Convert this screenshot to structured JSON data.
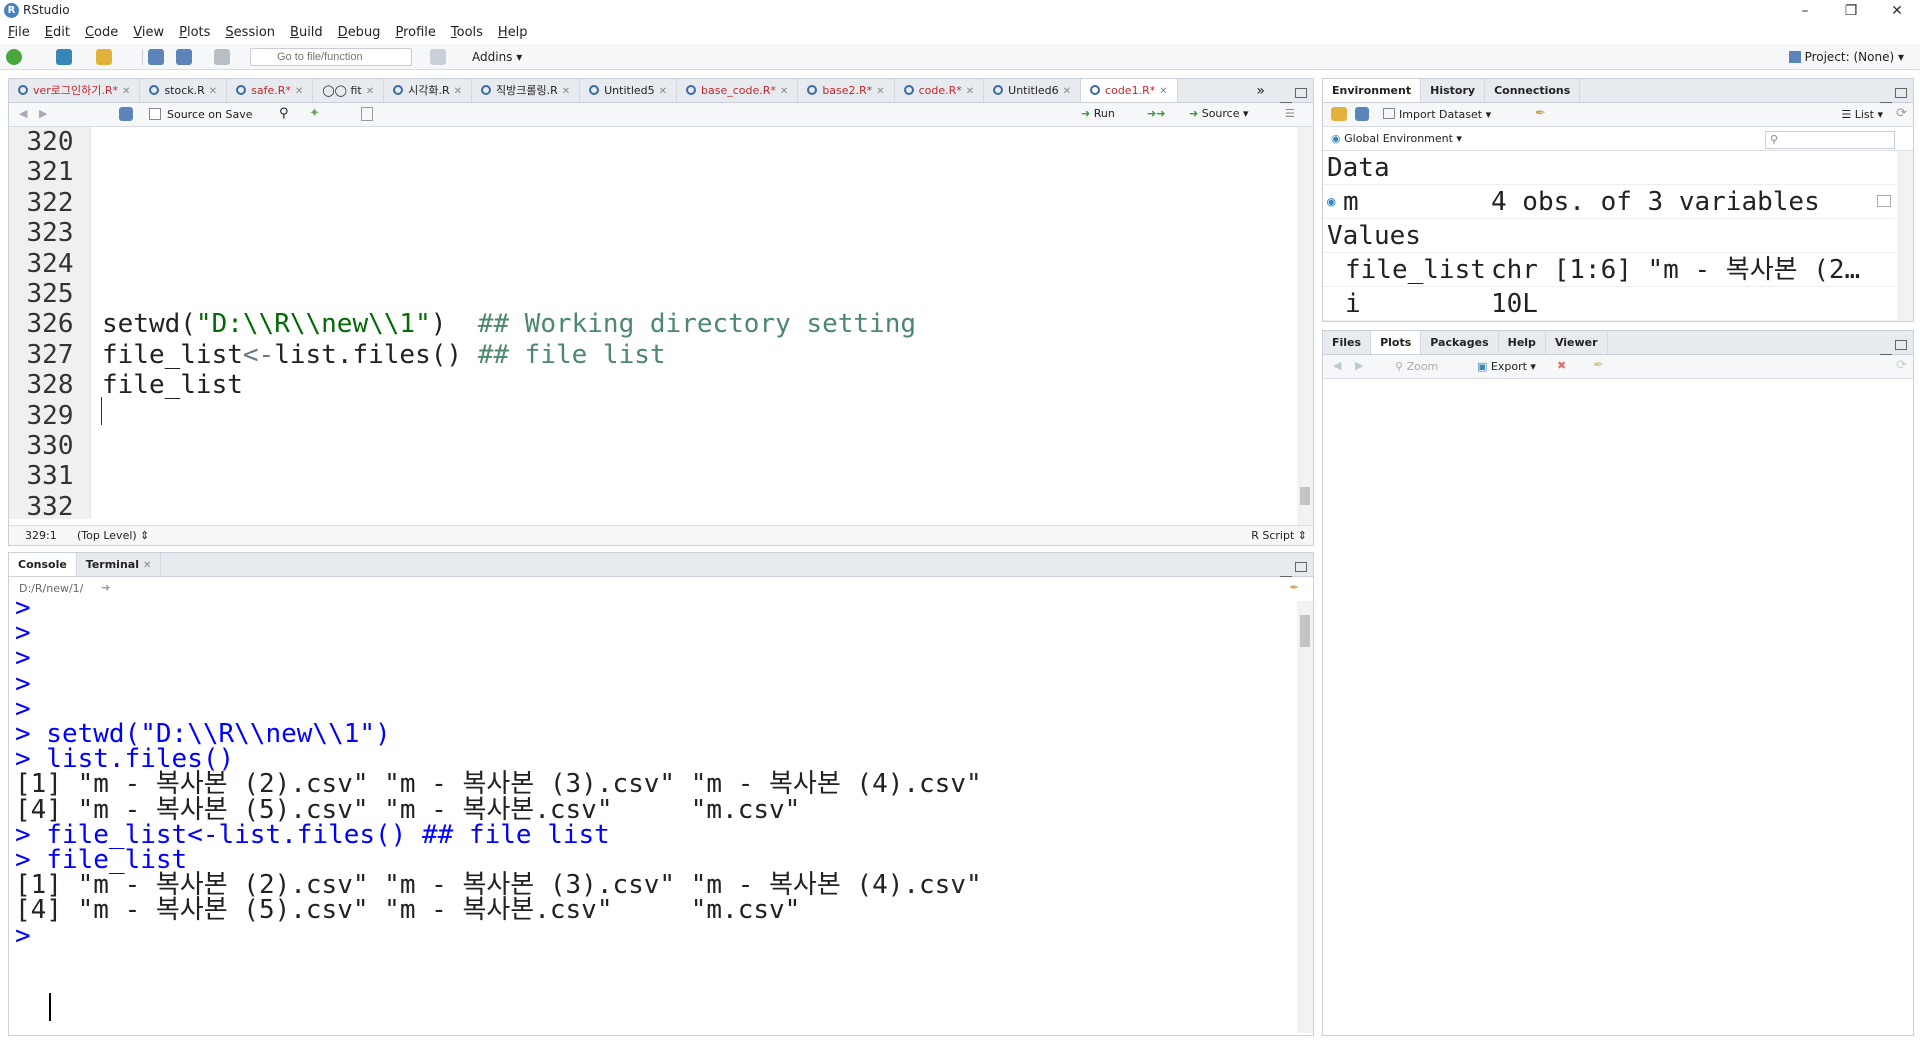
{
  "window": {
    "title": "RStudio"
  },
  "menu": [
    "File",
    "Edit",
    "Code",
    "View",
    "Plots",
    "Session",
    "Build",
    "Debug",
    "Profile",
    "Tools",
    "Help"
  ],
  "toolbar": {
    "goto_placeholder": "Go to file/function",
    "addins": "Addins",
    "project": "Project: (None)"
  },
  "editor": {
    "tabs": [
      {
        "label": "ver로그인하기.R*",
        "modified": true
      },
      {
        "label": "stock.R",
        "modified": false
      },
      {
        "label": "safe.R*",
        "modified": true
      },
      {
        "label": "fit",
        "modified": false
      },
      {
        "label": "시각화.R",
        "modified": false
      },
      {
        "label": "직방크롤링.R",
        "modified": false
      },
      {
        "label": "Untitled5",
        "modified": false
      },
      {
        "label": "base_code.R*",
        "modified": true
      },
      {
        "label": "base2.R*",
        "modified": true
      },
      {
        "label": "code.R*",
        "modified": true
      },
      {
        "label": "Untitled6",
        "modified": false
      },
      {
        "label": "code1.R*",
        "modified": true
      }
    ],
    "source_on_save": "Source on Save",
    "run_label": "Run",
    "source_label": "Source",
    "lines": [
      {
        "num": "320",
        "code": ""
      },
      {
        "num": "321",
        "code": ""
      },
      {
        "num": "322",
        "code": ""
      },
      {
        "num": "323",
        "code": ""
      },
      {
        "num": "324",
        "code": ""
      },
      {
        "num": "325",
        "code": ""
      },
      {
        "num": "326",
        "code": "setwd(\"D:\\\\R\\\\new\\\\1\")  ## Working directory setting"
      },
      {
        "num": "327",
        "code": "file_list<-list.files() ## file list"
      },
      {
        "num": "328",
        "code": "file_list"
      },
      {
        "num": "329",
        "code": ""
      },
      {
        "num": "330",
        "code": ""
      },
      {
        "num": "331",
        "code": ""
      },
      {
        "num": "332",
        "code": ""
      }
    ],
    "status_position": "329:1",
    "status_scope": "(Top Level)",
    "status_type": "R Script"
  },
  "console": {
    "tabs": [
      "Console",
      "Terminal"
    ],
    "path": "D:/R/new/1/",
    "lines": [
      {
        "prompt": ">",
        "text": ""
      },
      {
        "prompt": ">",
        "text": ""
      },
      {
        "prompt": ">",
        "text": ""
      },
      {
        "prompt": ">",
        "text": ""
      },
      {
        "prompt": ">",
        "text": ""
      },
      {
        "prompt": ">",
        "text": " setwd(\"D:\\\\R\\\\new\\\\1\")"
      },
      {
        "prompt": ">",
        "text": " list.files()"
      },
      {
        "prompt": "",
        "text": "[1] \"m - 복사본 (2).csv\" \"m - 복사본 (3).csv\" \"m - 복사본 (4).csv\""
      },
      {
        "prompt": "",
        "text": "[4] \"m - 복사본 (5).csv\" \"m - 복사본.csv\"     \"m.csv\""
      },
      {
        "prompt": ">",
        "text": " file_list<-list.files() ## file list"
      },
      {
        "prompt": ">",
        "text": " file_list"
      },
      {
        "prompt": "",
        "text": "[1] \"m - 복사본 (2).csv\" \"m - 복사본 (3).csv\" \"m - 복사본 (4).csv\""
      },
      {
        "prompt": "",
        "text": "[4] \"m - 복사본 (5).csv\" \"m - 복사본.csv\"     \"m.csv\""
      },
      {
        "prompt": ">",
        "text": " "
      }
    ]
  },
  "environment": {
    "tabs": [
      "Environment",
      "History",
      "Connections"
    ],
    "import_dataset": "Import Dataset",
    "list_label": "List",
    "scope": "Global Environment",
    "data_header": "Data",
    "values_header": "Values",
    "data": [
      {
        "name": "m",
        "value": "4 obs. of 3 variables"
      }
    ],
    "values": [
      {
        "name": "file_list",
        "value": "chr [1:6] \"m - 복사본 (2…"
      },
      {
        "name": "i",
        "value": "10L"
      }
    ]
  },
  "files": {
    "tabs": [
      "Files",
      "Plots",
      "Packages",
      "Help",
      "Viewer"
    ],
    "zoom": "Zoom",
    "export": "Export"
  }
}
